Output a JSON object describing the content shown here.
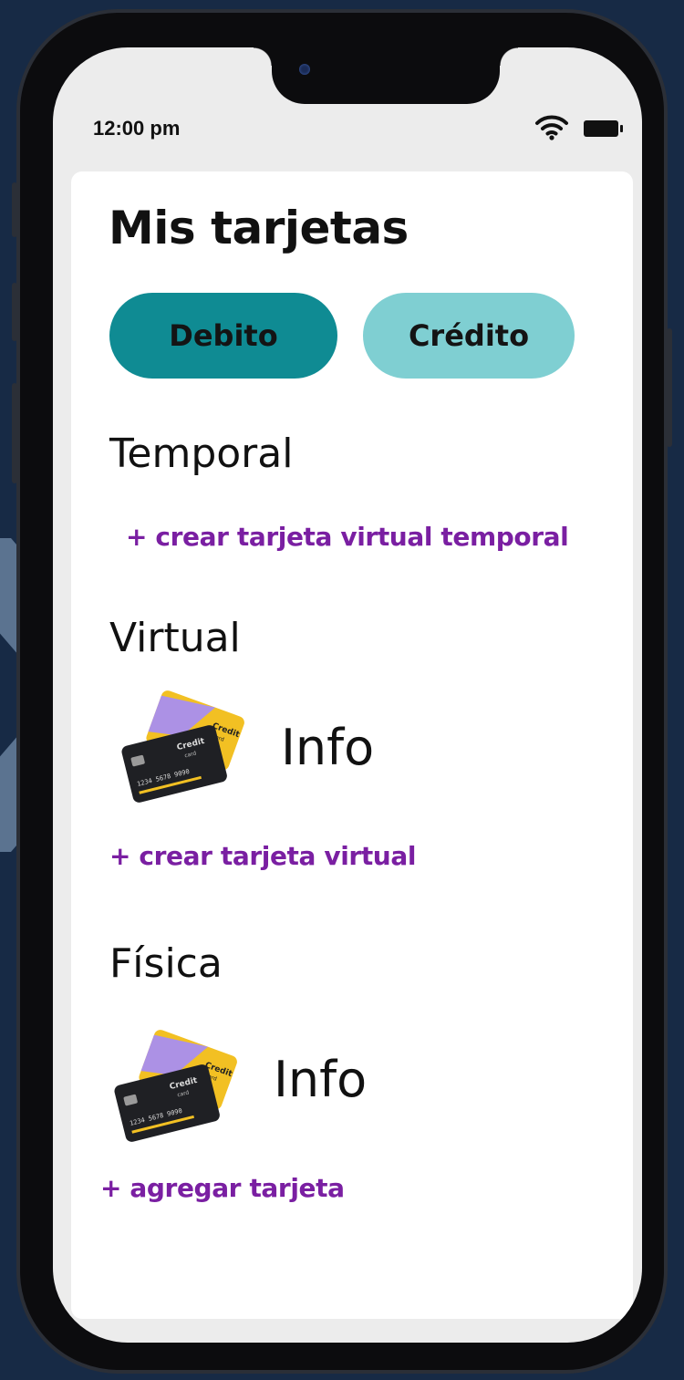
{
  "status_bar": {
    "time": "12:00 pm"
  },
  "page": {
    "title": "Mis tarjetas"
  },
  "tabs": [
    {
      "label": "Debito",
      "selected": true
    },
    {
      "label": "Crédito",
      "selected": false
    }
  ],
  "sections": {
    "temporal": {
      "heading": "Temporal",
      "action_label": "+ crear tarjeta virtual temporal"
    },
    "virtual": {
      "heading": "Virtual",
      "card_info_label": "Info",
      "action_label": "+ crear tarjeta virtual"
    },
    "fisica": {
      "heading": "Física",
      "card_info_label": "Info",
      "action_label": "+ agregar tarjeta"
    }
  },
  "card_illustration": {
    "front_card_brand": "Credit",
    "front_card_sub": "card",
    "front_card_number": "1234 5678 9090",
    "back_card_brand": "Credit",
    "back_card_sub": "card"
  },
  "colors": {
    "background": "#172a45",
    "chevron": "#5b7390",
    "tab_selected": "#0f8b93",
    "tab_unselected": "#7fcfd2",
    "link": "#7a1fa2",
    "screen_bg": "#ececec"
  }
}
